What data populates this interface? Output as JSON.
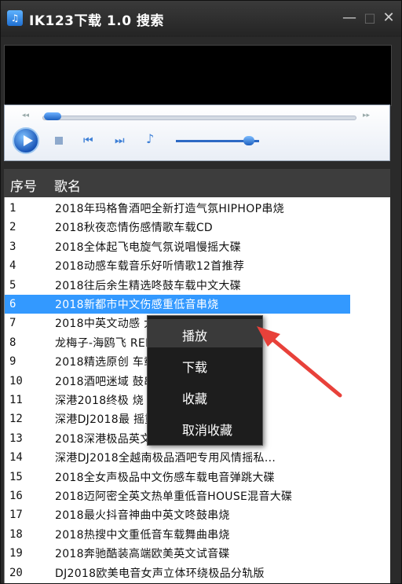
{
  "window": {
    "icon": "♫",
    "title": "IK123下载 1.0  搜索",
    "min": "—",
    "max": "□",
    "close": "✕"
  },
  "player": {
    "seek_left": "◂◂",
    "seek_right": "▸▸",
    "prev": "⏮",
    "next": "⏭",
    "vol": "♪"
  },
  "list": {
    "headers": [
      "序号",
      "歌名"
    ],
    "rows": [
      {
        "idx": "1",
        "name": "2018年玛格鲁酒吧全新打造气氛HIPHOP串烧"
      },
      {
        "idx": "2",
        "name": "2018秋夜恋情伤感情歌车载CD"
      },
      {
        "idx": "3",
        "name": "2018全体起飞电旋气氛说唱慢摇大碟"
      },
      {
        "idx": "4",
        "name": "2018动感车载音乐好听情歌12首推荐"
      },
      {
        "idx": "5",
        "name": "2018往后余生精选咚鼓车载中文大碟"
      },
      {
        "idx": "6",
        "name": "2018新都市中文伤感重低音串烧"
      },
      {
        "idx": "7",
        "name": "2018中英文动感                  大碟"
      },
      {
        "idx": "8",
        "name": "龙梅子-海鸥飞                      REMIX"
      },
      {
        "idx": "9",
        "name": "2018精选原创                    车载CD"
      },
      {
        "idx": "10",
        "name": "2018酒吧迷域                  鼓串烧"
      },
      {
        "idx": "11",
        "name": "深港2018终极                    烧"
      },
      {
        "idx": "12",
        "name": "深港DJ2018最                  摇重低音..."
      },
      {
        "idx": "13",
        "name": "2018深港极品英文电音舞曲"
      },
      {
        "idx": "14",
        "name": "深港DJ2018全越南极品酒吧专用风情摇私..."
      },
      {
        "idx": "15",
        "name": "2018全女声极品中文伤感车载电音弹跳大碟"
      },
      {
        "idx": "16",
        "name": "2018迈阿密全英文热单重低音HOUSE混音大碟"
      },
      {
        "idx": "17",
        "name": "2018最火抖音神曲中英文咚鼓串烧"
      },
      {
        "idx": "18",
        "name": "2018热搜中文重低音车载舞曲串烧"
      },
      {
        "idx": "19",
        "name": "2018奔驰酷装高端欧美英文试音碟"
      },
      {
        "idx": "20",
        "name": "DJ2018欧美电音女声立体环绕极品分轨版"
      }
    ]
  },
  "menu": {
    "items": [
      "播放",
      "下载",
      "收藏",
      "取消收藏"
    ]
  },
  "colors": {
    "selection": "#3399ff",
    "arrow": "#e8413a"
  }
}
